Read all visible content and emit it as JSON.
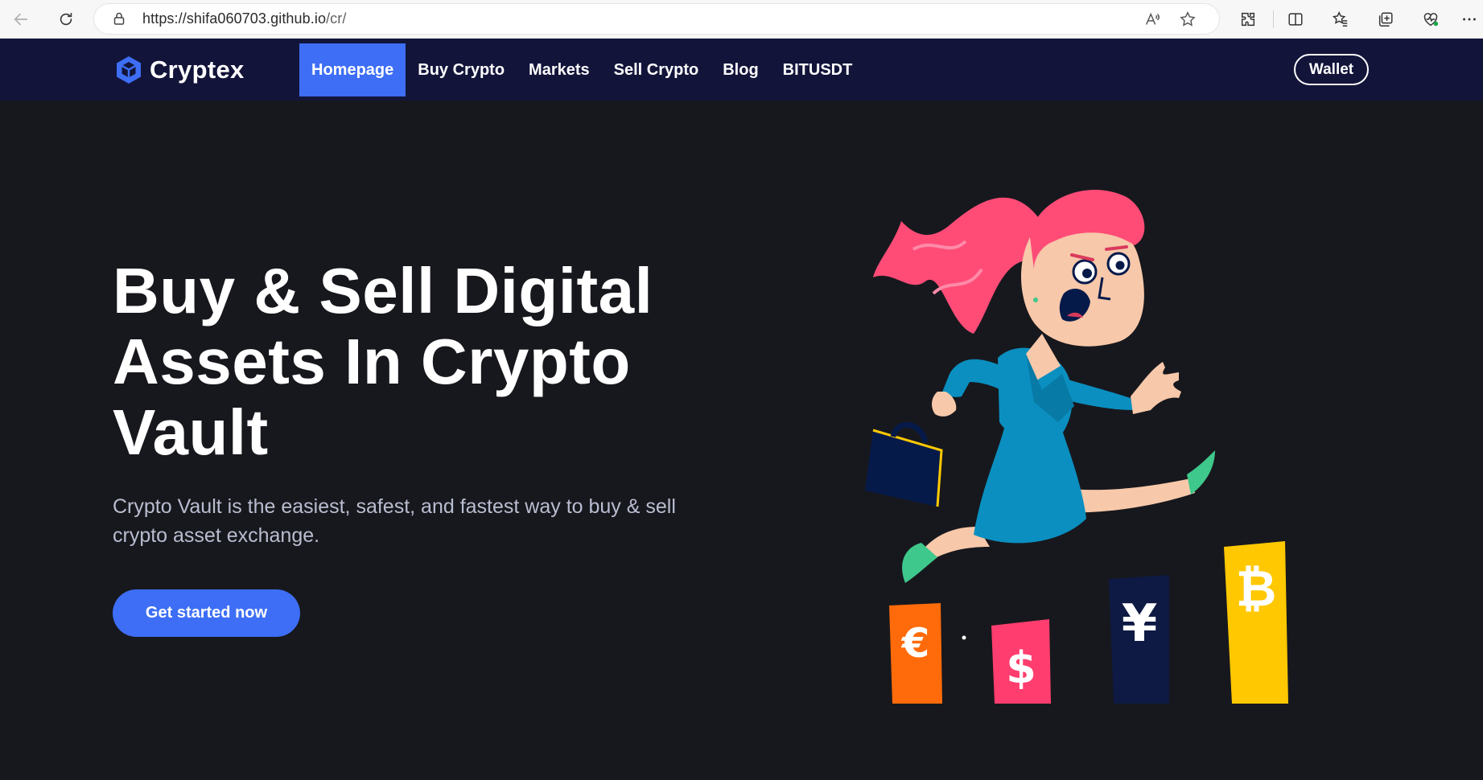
{
  "browser": {
    "url_host": "https://shifa060703.github.io",
    "url_path": "/cr/",
    "icons": [
      "back-icon",
      "refresh-icon",
      "lock-icon",
      "read-aloud-icon",
      "favorite-star-icon",
      "extensions-icon",
      "split-screen-icon",
      "favorites-icon",
      "collections-icon",
      "browser-essentials-icon",
      "more-icon"
    ]
  },
  "nav": {
    "brand": "Cryptex",
    "links": [
      {
        "label": "Homepage",
        "active": true
      },
      {
        "label": "Buy Crypto"
      },
      {
        "label": "Markets"
      },
      {
        "label": "Sell Crypto"
      },
      {
        "label": "Blog"
      },
      {
        "label": "BITUSDT"
      }
    ],
    "wallet_label": "Wallet"
  },
  "hero": {
    "title": "Buy & Sell Digital Assets In Crypto Vault",
    "subtitle": "Crypto Vault is the easiest, safest, and fastest way to buy & sell crypto asset exchange.",
    "cta_label": "Get started now"
  },
  "illustration": {
    "currency_glyphs": [
      "€",
      "$",
      "¥",
      "₿"
    ],
    "colors": {
      "euro": "#ff6b0a",
      "dollar": "#ff3d6e",
      "yuan": "#0e1a44",
      "bitcoin": "#ffc800"
    }
  },
  "colors": {
    "accent": "#3d6ef5",
    "nav_bg": "#12143a",
    "page_bg": "#17181d"
  }
}
